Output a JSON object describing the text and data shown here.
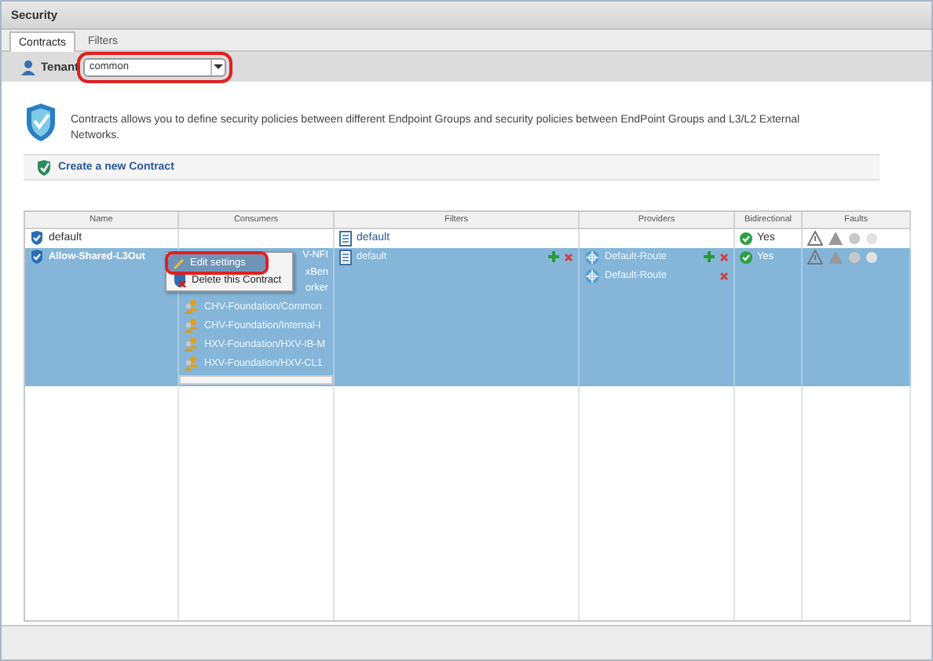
{
  "window": {
    "title": "Security"
  },
  "tabs": [
    {
      "label": "Contracts",
      "selected": true
    },
    {
      "label": "Filters",
      "selected": false
    }
  ],
  "tenant": {
    "label": "Tenant",
    "value": "common"
  },
  "description": "Contracts allows you to define security policies between different Endpoint Groups and security policies between EndPoint Groups and L3/L2 External Networks.",
  "create_link": "Create a new Contract",
  "table": {
    "columns": [
      "Name",
      "Consumers",
      "Filters",
      "Providers",
      "Bidirectional",
      "Faults"
    ],
    "rows": [
      {
        "name": "default",
        "selected": false,
        "consumers": [],
        "filters": [
          "default"
        ],
        "providers": [],
        "bidirectional": "Yes"
      },
      {
        "name": "Allow-Shared-L3Out",
        "selected": true,
        "consumers": [
          {
            "kind": "cut",
            "text": "V-NFI"
          },
          {
            "kind": "cut",
            "text": "xBen"
          },
          {
            "kind": "cut",
            "text": "orker"
          },
          {
            "kind": "full",
            "text": "CHV-Foundation/Common"
          },
          {
            "kind": "full",
            "text": "CHV-Foundation/Internal-I"
          },
          {
            "kind": "full",
            "text": "HXV-Foundation/HXV-IB-M"
          },
          {
            "kind": "full",
            "text": "HXV-Foundation/HXV-CL1"
          }
        ],
        "filters": [
          "default"
        ],
        "providers": [
          "Default-Route",
          "Default-Route"
        ],
        "bidirectional": "Yes"
      }
    ]
  },
  "context_menu": {
    "items": [
      {
        "label": "Edit settings",
        "selected": true
      },
      {
        "label": "Delete this Contract",
        "selected": false
      }
    ]
  }
}
